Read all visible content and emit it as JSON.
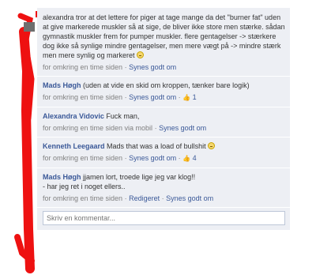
{
  "comments": [
    {
      "author": "",
      "text": "alexandra tror at det lettere for piger at tage mange da det \"burner fat\" uden at give markerede muskler så at sige, de bliver ikke store men stærke. sådan gymnastik muskler frem for pumper muskler. flere gentagelser -> stærkere dog ikke så synlige mindre gentagelser, men mere vægt på -> mindre stærk men mere synlig og markeret",
      "time": "for omkring en time siden",
      "like": "Synes godt om"
    },
    {
      "author": "Mads Høgh",
      "text": "(uden at vide en skid om kroppen, tænker bare logik)",
      "time": "for omkring en time siden",
      "like": "Synes godt om",
      "likes": "1"
    },
    {
      "author": "Alexandra Vidovic",
      "text": "Fuck man,",
      "time": "for omkring en time siden via mobil",
      "like": "Synes godt om"
    },
    {
      "author": "Kenneth Leegaard",
      "text": "Mads that was a load of bullshit",
      "time": "for omkring en time siden",
      "like": "Synes godt om",
      "likes": "4"
    },
    {
      "author": "Mads Høgh",
      "text_line1": "jjamen lort, troede lige jeg var klog!!",
      "text_line2": "- har jeg ret i noget ellers..",
      "time": "for omkring en time siden",
      "edit": "Redigeret",
      "like": "Synes godt om"
    }
  ],
  "input": {
    "placeholder": "Skriv en kommentar..."
  },
  "colors": {
    "link": "#3b5998",
    "comment_bg": "#edeff4",
    "scribble": "#ee1111"
  }
}
